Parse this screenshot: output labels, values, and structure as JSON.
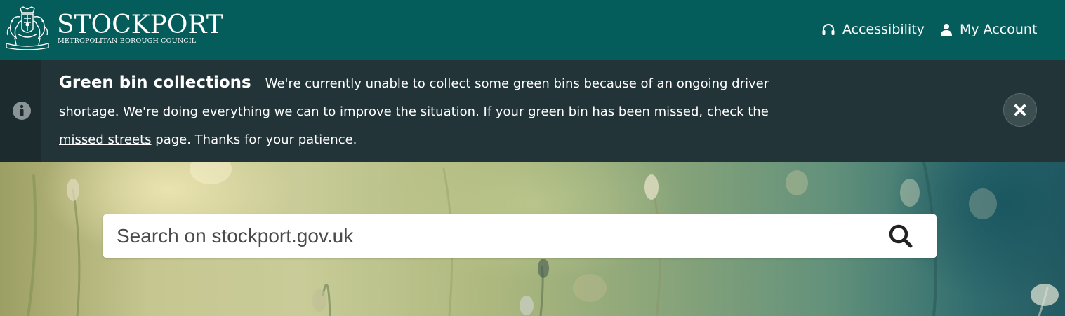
{
  "header": {
    "logo_title": "STOCKPORT",
    "logo_subtitle": "METROPOLITAN BOROUGH COUNCIL",
    "nav": {
      "accessibility": {
        "label": "Accessibility",
        "icon": "headphones-icon"
      },
      "account": {
        "label": "My Account",
        "icon": "user-icon"
      }
    }
  },
  "alert": {
    "icon": "info-icon",
    "heading": "Green bin collections",
    "body_before_link": "We're currently unable to collect some green bins because of an ongoing driver shortage. We're doing everything we can to improve the situation. If your green bin has been missed, check the ",
    "link_text": "missed streets",
    "body_after_link": " page. Thanks for your patience.",
    "close_icon": "close-icon"
  },
  "search": {
    "placeholder": "Search on stockport.gov.uk",
    "value": "",
    "icon": "search-icon"
  },
  "colors": {
    "header_bg": "#055d5b",
    "alert_bg": "#223438",
    "alert_iconbar_bg": "#1b2b2e",
    "text": "#ffffff"
  }
}
